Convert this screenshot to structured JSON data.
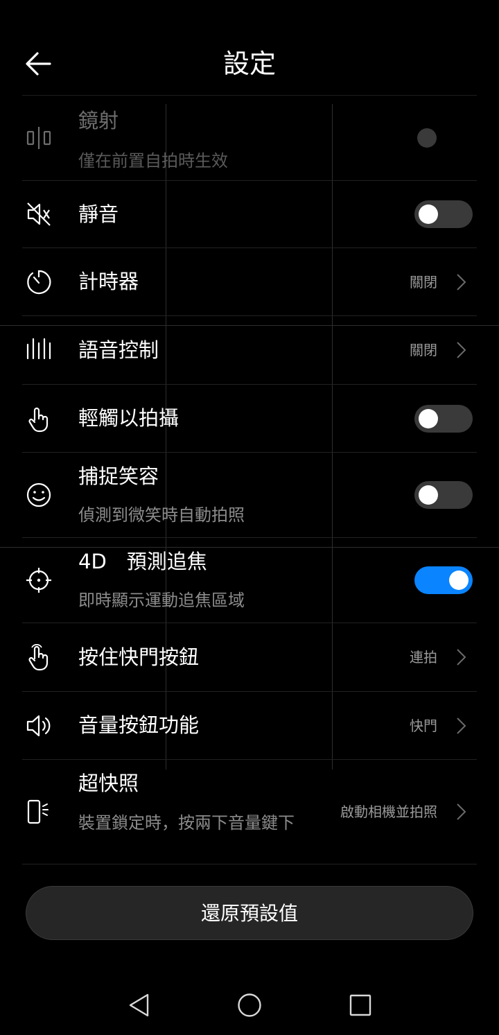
{
  "header": {
    "title": "設定",
    "back_icon": "arrow-left-icon"
  },
  "settings": [
    {
      "id": "mirror",
      "label": "鏡射",
      "sub": "僅在前置自拍時生效",
      "icon": "mirror-icon",
      "control": "disabled-toggle"
    },
    {
      "id": "mute",
      "label": "靜音",
      "icon": "speaker-mute-icon",
      "control": "toggle",
      "on": false
    },
    {
      "id": "timer",
      "label": "計時器",
      "icon": "timer-icon",
      "control": "value",
      "value": "關閉"
    },
    {
      "id": "voice",
      "label": "語音控制",
      "icon": "voice-bars-icon",
      "control": "value",
      "value": "關閉"
    },
    {
      "id": "touch",
      "label": "輕觸以拍攝",
      "icon": "tap-hand-icon",
      "control": "toggle",
      "on": false
    },
    {
      "id": "smile",
      "label": "捕捉笑容",
      "sub": "偵測到微笑時自動拍照",
      "icon": "smile-icon",
      "control": "toggle",
      "on": false
    },
    {
      "id": "focus",
      "label": "4D　預測追焦",
      "sub": "即時顯示運動追焦區域",
      "icon": "crosshair-icon",
      "control": "toggle",
      "on": true
    },
    {
      "id": "hold",
      "label": "按住快門按鈕",
      "icon": "hold-hand-icon",
      "control": "value",
      "value": "連拍"
    },
    {
      "id": "volume",
      "label": "音量按鈕功能",
      "icon": "speaker-icon",
      "control": "value",
      "value": "快門"
    },
    {
      "id": "ultra",
      "label": "超快照",
      "sub": "裝置鎖定時，按兩下音量鍵下",
      "icon": "phone-snap-icon",
      "control": "value",
      "value": "啟動相機並拍照"
    }
  ],
  "reset_label": "還原預設值",
  "accent_color": "#0a84ff",
  "nav": {
    "back_icon": "triangle-back-icon",
    "home_icon": "circle-home-icon",
    "recents_icon": "square-recents-icon"
  }
}
